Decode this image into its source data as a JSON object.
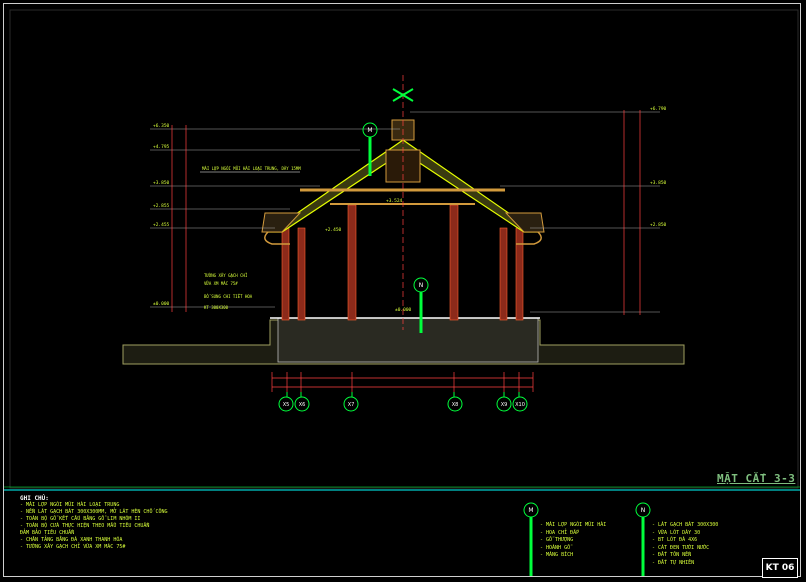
{
  "drawing": {
    "sheet_title": "MẶT CẮT 3-3",
    "sheet_code": "KT 06"
  },
  "section": {
    "level_labels_left": [
      "+6.350",
      "+4.795",
      "+3.850",
      "+2.855",
      "+2.455",
      "±0.000"
    ],
    "level_labels_right": [
      "+6.790",
      "+3.850",
      "+2.850"
    ],
    "center_level_labels": [
      "+3.524",
      "±0.000"
    ],
    "side_level_label": "+2.450",
    "callout_roof": "MÁI LỢP NGÓI MŨI HÀI LOẠI TRUNG, DÀY 15MM",
    "wall_notes": [
      "TƯỜNG XÂY GẠCH CHỈ",
      "VỮA XM MÁC 75#",
      "BỔ SUNG CHI TIẾT HOA",
      "KT 300X300"
    ],
    "axis_labels": [
      "X5",
      "X6",
      "X7",
      "X8",
      "X9",
      "X10"
    ],
    "grid_markers": [
      "M",
      "N"
    ]
  },
  "notes": {
    "heading": "GHI CHÚ:",
    "items": [
      "- MÁI LỢP NGÓI MŨI HÀI LOẠI TRUNG",
      "- NỀN LÁT GẠCH BÁT 300X300MM, MỞ LÁT HÈN CHỐ CÔNG",
      "- TOÀN BỘ GỖ KẾT CẤU BẰNG GỖ LIM NHÓM II",
      "- TOÀN BỘ CỬA THỰC HIỆN THEO MẪU TIÊU CHUẨN",
      "  ĐẢM BẢO TIÊU CHUẨN",
      "- CHÂN TẢNG BẰNG ĐÁ XANH THANH HÓA",
      "- TƯỜNG XÂY GẠCH CHỈ VỮA XM MÁC 75#"
    ]
  },
  "legend_m": {
    "marker": "M",
    "items": [
      "- MÁI LỢP NGÓI MŨI HÀI",
      "- HOA CHỈ ĐẮP",
      "- GỖ THƯỢNG",
      "- HOÀNH GỖ",
      "- MÁNG BÍCH"
    ]
  },
  "legend_n": {
    "marker": "N",
    "items": [
      "- LÁT GẠCH BÁT 300X300",
      "- VỮA LÓT DÀY 30",
      "- BT LÓT ĐÁ 4X6",
      "- CÁT ĐEN TƯỚI NƯỚC",
      "- ĐẤT TÔN NỀN",
      "- ĐẤT TỰ NHIÊN"
    ]
  },
  "colors": {
    "outline": "#ffffff",
    "roof_hatch": "#e6ff00",
    "timber": "#d29a3c",
    "columns": "#8c2a1a",
    "dimension": "#ff4040",
    "annotation": "#d8ff3a",
    "marker_green": "#00ff3c",
    "ground": "#a0a060",
    "title_green": "#7fbf7f"
  }
}
